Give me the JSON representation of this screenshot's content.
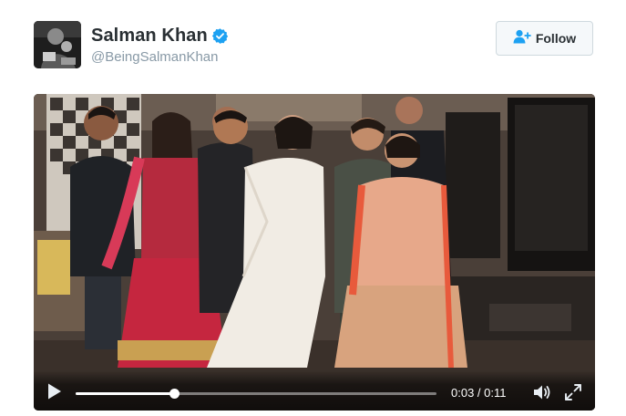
{
  "user": {
    "display_name": "Salman Khan",
    "handle": "@BeingSalmanKhan",
    "verified": true
  },
  "follow_button": {
    "label": "Follow",
    "icon": "add-user-icon"
  },
  "video": {
    "current_time": "0:03",
    "duration": "0:11",
    "time_display": "0:03 / 0:11",
    "progress_fraction": 0.273,
    "play_icon": "play-icon",
    "volume_icon": "volume-icon",
    "fullscreen_icon": "expand-icon"
  },
  "colors": {
    "name_text": "#292f33",
    "handle_text": "#8899a6",
    "verified_blue": "#1da1f2",
    "follow_icon_blue": "#1da1f2"
  }
}
